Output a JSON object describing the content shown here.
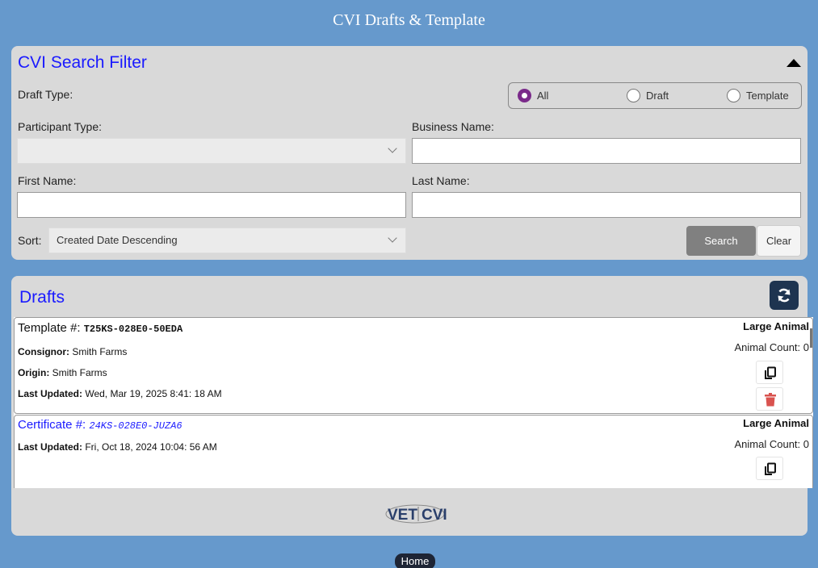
{
  "app_title": "CVI Drafts & Template",
  "filter": {
    "title": "CVI Search Filter",
    "draft_type_label": "Draft Type:",
    "radio": {
      "all": "All",
      "draft": "Draft",
      "template": "Template",
      "selected": "All"
    },
    "participant_type_label": "Participant Type:",
    "participant_type_value": "",
    "business_name_label": "Business Name:",
    "business_name_value": "",
    "first_name_label": "First Name:",
    "first_name_value": "",
    "last_name_label": "Last Name:",
    "last_name_value": "",
    "sort_label": "Sort:",
    "sort_value": "Created Date Descending",
    "search_label": "Search",
    "clear_label": "Clear"
  },
  "drafts": {
    "title": "Drafts",
    "cards": [
      {
        "title_prefix": "Template #: ",
        "id": "T25KS-028E0-50EDA",
        "consignor_label": "Consignor:",
        "consignor": " Smith Farms",
        "origin_label": "Origin:",
        "origin": " Smith Farms",
        "updated_label": "Last Updated:",
        "updated": " Wed, Mar 19, 2025 8:41: 18 AM",
        "type": "Large Animal",
        "animal_count": "Animal Count: 0"
      },
      {
        "title_prefix": "Certificate #: ",
        "id": "24KS-028E0-JUZA6",
        "updated_label": "Last Updated:",
        "updated": " Fri, Oct 18, 2024 10:04: 56 AM",
        "type": "Large Animal",
        "animal_count": "Animal Count: 0"
      }
    ]
  },
  "logo": {
    "vet": "VET",
    "cvi": "CVI"
  },
  "home_label": "Home",
  "colors": {
    "background": "#6699cc",
    "panel": "#d9d9d9",
    "accent_text": "#1a1aff",
    "radio_selected": "#7a2a8a",
    "delete": "#d9534f",
    "dark_button": "#1e3450"
  }
}
